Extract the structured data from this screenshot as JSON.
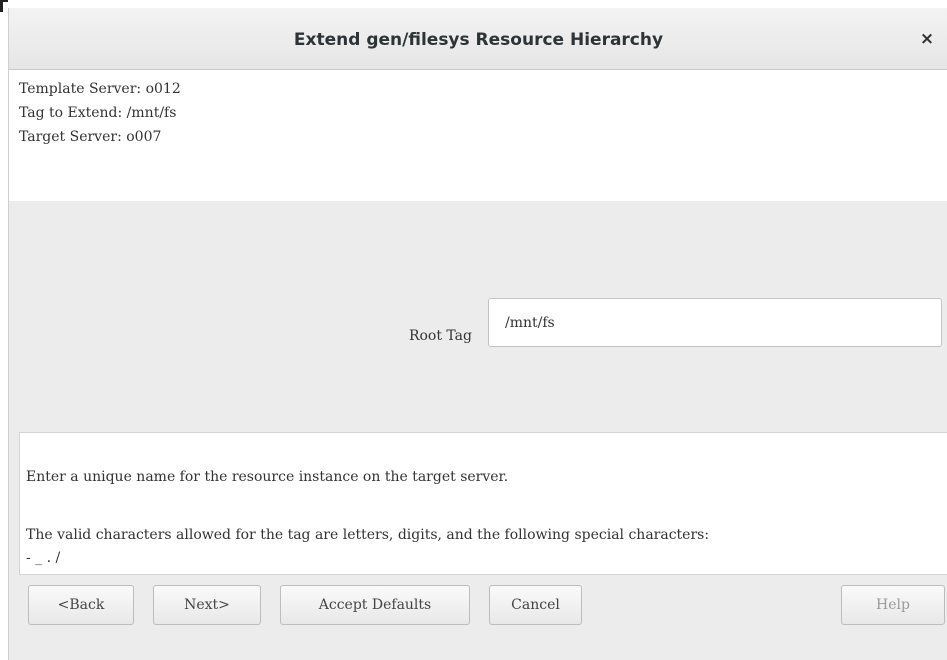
{
  "window": {
    "title": "Extend gen/filesys Resource Hierarchy",
    "close_glyph": "×"
  },
  "info": {
    "template_server": "Template Server: o012",
    "tag_to_extend": "Tag to Extend: /mnt/fs",
    "target_server": "Target Server: o007"
  },
  "form": {
    "root_tag_label": "Root Tag",
    "root_tag_value": "/mnt/fs"
  },
  "help": {
    "line1": "Enter a unique name for the resource instance on the target server.",
    "line2": "The valid characters allowed for the tag are letters, digits, and the following special characters:",
    "line3": "- _ . /"
  },
  "buttons": {
    "back": "<Back",
    "next": "Next>",
    "accept_defaults": "Accept Defaults",
    "cancel": "Cancel",
    "help": "Help"
  }
}
